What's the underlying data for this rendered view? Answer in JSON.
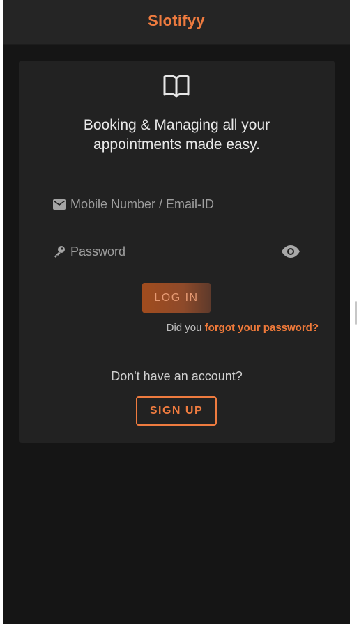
{
  "app": {
    "title": "Slotifyy",
    "accent_color": "#ee7b3f"
  },
  "card": {
    "icon": "open-book-icon",
    "tagline": "Booking & Managing all your\nappointments made easy."
  },
  "form": {
    "email": {
      "icon": "envelope-icon",
      "placeholder": "Mobile Number / Email-ID",
      "value": ""
    },
    "password": {
      "icon": "key-icon",
      "placeholder": "Password",
      "value": "",
      "toggle_icon": "eye-icon"
    },
    "login_label": "LOG IN",
    "forgot_prefix": "Did you ",
    "forgot_link": "forgot your password?"
  },
  "signup": {
    "prompt": "Don't have an account?",
    "button_label": "SIGN UP"
  }
}
